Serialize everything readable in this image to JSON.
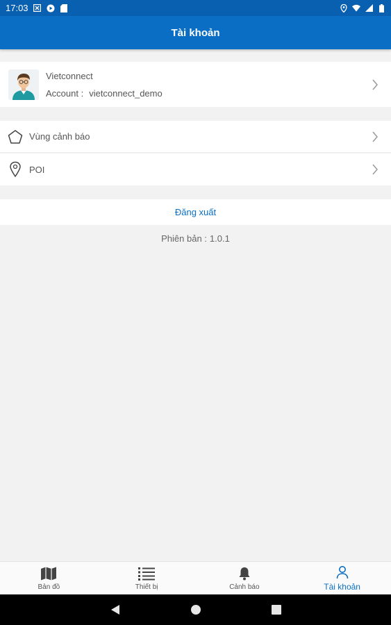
{
  "status_bar": {
    "time": "17:03",
    "left_icons": [
      "notification-x-icon",
      "google-play-icon",
      "sd-card-icon"
    ],
    "right_icons": [
      "location-icon",
      "wifi-icon",
      "signal-icon",
      "battery-icon"
    ]
  },
  "app_bar": {
    "title": "Tài khoản"
  },
  "profile": {
    "name": "Vietconnect",
    "account_label": "Account :",
    "account_value": "vietconnect_demo",
    "avatar_icon": "user-avatar-icon"
  },
  "menu": {
    "items": [
      {
        "label": "Vùng cảnh báo",
        "icon": "pentagon-icon"
      },
      {
        "label": "POI",
        "icon": "map-pin-icon"
      }
    ]
  },
  "logout": {
    "label": "Đăng xuất"
  },
  "version": {
    "label": "Phiên bản :",
    "value": "1.0.1"
  },
  "tabs": [
    {
      "label": "Bản đồ",
      "icon": "map-icon",
      "active": false
    },
    {
      "label": "Thiết bị",
      "icon": "list-icon",
      "active": false
    },
    {
      "label": "Cảnh báo",
      "icon": "bell-icon",
      "active": false
    },
    {
      "label": "Tài khoản",
      "icon": "person-icon",
      "active": true
    }
  ],
  "nav_bar": {
    "buttons": [
      "back-icon",
      "home-icon",
      "recents-icon"
    ]
  },
  "colors": {
    "primary": "#0a6fc4",
    "status_bar": "#0a60b0",
    "background": "#f2f2f2",
    "active_tab": "#0a6fc4"
  }
}
